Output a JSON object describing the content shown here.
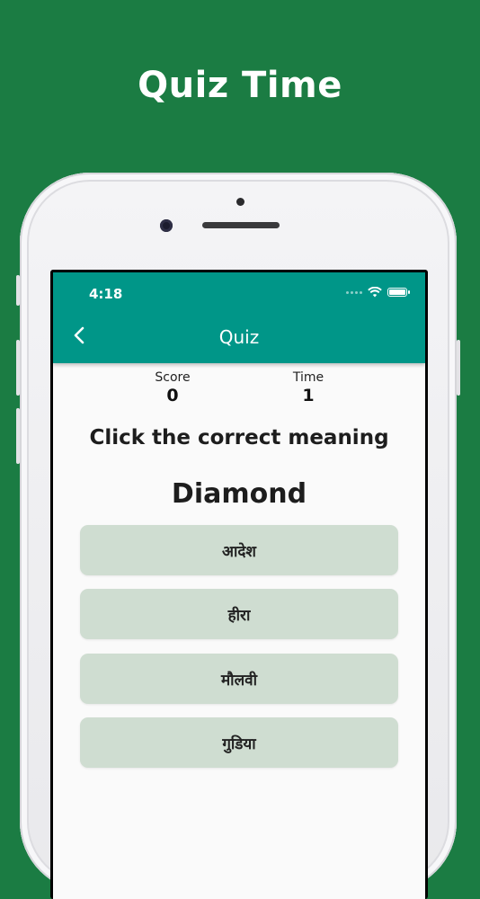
{
  "promo": {
    "headline": "Quiz Time"
  },
  "status_bar": {
    "time": "4:18"
  },
  "app_bar": {
    "title": "Quiz"
  },
  "stats": {
    "score_label": "Score",
    "score_value": "0",
    "time_label": "Time",
    "time_value": "1"
  },
  "quiz": {
    "instruction": "Click the correct meaning",
    "word": "Diamond",
    "options": [
      "आदेश",
      "हीरा",
      "मौलवी",
      "गुडिया"
    ]
  },
  "colors": {
    "background": "#1b7c43",
    "app_bar": "#009688",
    "option_fill": "#cfddd1"
  },
  "icons": [
    "back-arrow-icon",
    "wifi-icon",
    "battery-icon",
    "signal-icon"
  ]
}
